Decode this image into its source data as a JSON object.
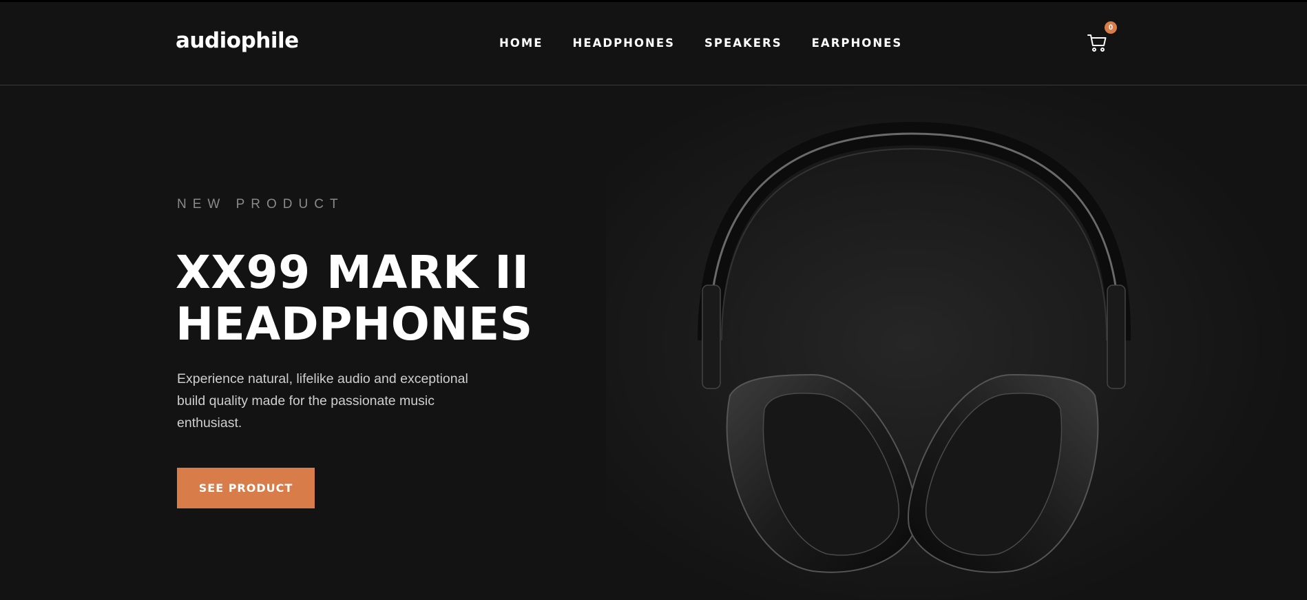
{
  "brand": {
    "logo": "audiophile"
  },
  "nav": {
    "items": [
      {
        "label": "HOME"
      },
      {
        "label": "HEADPHONES"
      },
      {
        "label": "SPEAKERS"
      },
      {
        "label": "EARPHONES"
      }
    ]
  },
  "cart": {
    "count": "0",
    "icon": "cart-icon"
  },
  "hero": {
    "eyebrow": "NEW PRODUCT",
    "title_line1": "XX99 MARK II",
    "title_line2": "HEADPHONES",
    "description": "Experience natural, lifelike audio and exceptional build quality made for the passionate music enthusiast.",
    "cta_label": "SEE PRODUCT",
    "image": "headphones-image"
  },
  "colors": {
    "accent": "#D87D4A",
    "background": "#131313",
    "text": "#FFFFFF"
  }
}
